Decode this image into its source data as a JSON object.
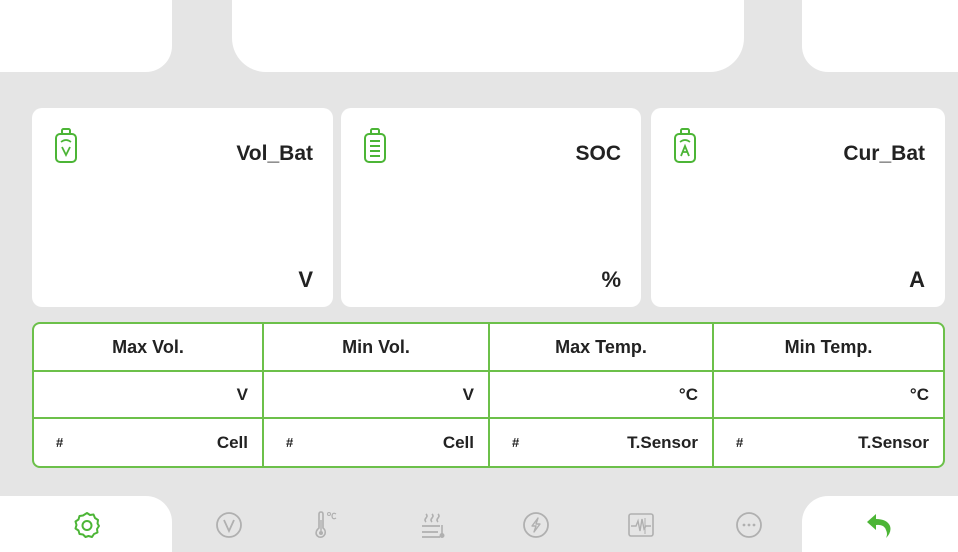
{
  "cards": [
    {
      "title": "Vol_Bat",
      "unit": "V",
      "icon": "battery-voltage-icon"
    },
    {
      "title": "SOC",
      "unit": "%",
      "icon": "battery-level-icon"
    },
    {
      "title": "Cur_Bat",
      "unit": "A",
      "icon": "battery-current-icon"
    }
  ],
  "stats": {
    "headers": [
      "Max Vol.",
      "Min Vol.",
      "Max Temp.",
      "Min Temp."
    ],
    "units": [
      "V",
      "V",
      "°C",
      "°C"
    ],
    "index_prefix": [
      "#",
      "#",
      "#",
      "#"
    ],
    "index_labels": [
      "Cell",
      "Cell",
      "T.Sensor",
      "T.Sensor"
    ]
  },
  "nav": {
    "items": [
      {
        "icon": "settings-icon",
        "active": true
      },
      {
        "icon": "voltage-icon",
        "active": false
      },
      {
        "icon": "temperature-icon",
        "active": false
      },
      {
        "icon": "heating-icon",
        "active": false
      },
      {
        "icon": "charge-icon",
        "active": false
      },
      {
        "icon": "waveform-icon",
        "active": false
      },
      {
        "icon": "more-icon",
        "active": false
      },
      {
        "icon": "back-icon",
        "active": true
      }
    ]
  },
  "colors": {
    "accent": "#4cb536",
    "border": "#6cc04a",
    "inactive_icon": "#b0b0b0",
    "background": "#e5e5e5"
  }
}
